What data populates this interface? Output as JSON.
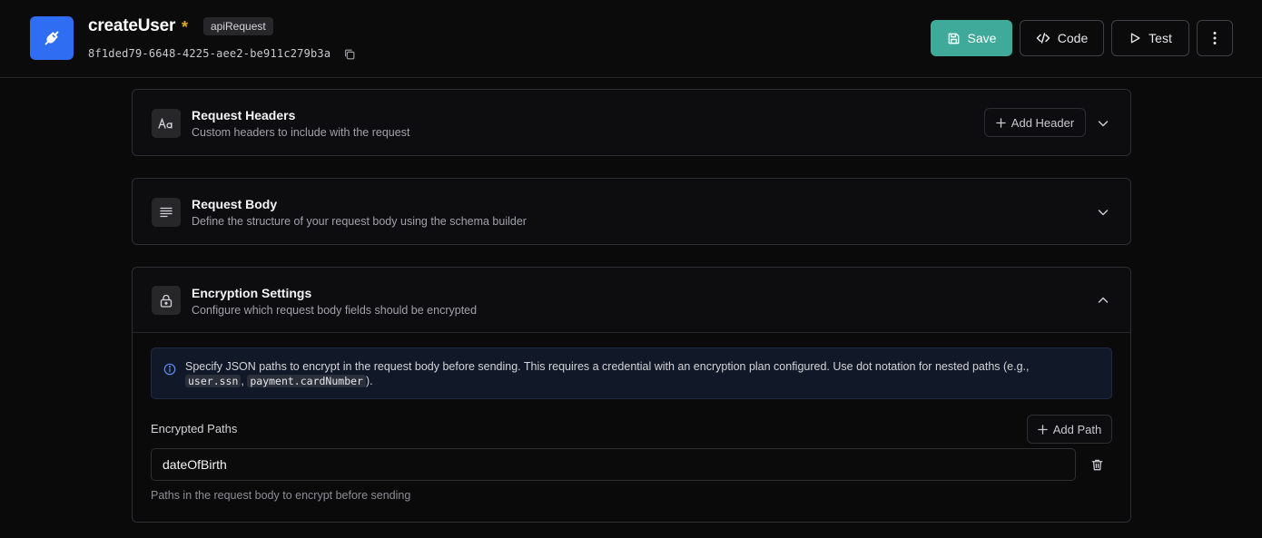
{
  "header": {
    "title": "createUser",
    "unsaved_marker": "*",
    "type_badge": "apiRequest",
    "uuid": "8f1ded79-6648-4225-aee2-be911c279b3a",
    "app_icon": "plug-icon",
    "buttons": {
      "save": "Save",
      "code": "Code",
      "test": "Test"
    }
  },
  "sections": {
    "headers": {
      "title": "Request Headers",
      "subtitle": "Custom headers to include with the request",
      "action": "Add Header",
      "icon": "text-aa-icon"
    },
    "body": {
      "title": "Request Body",
      "subtitle": "Define the structure of your request body using the schema builder",
      "icon": "align-left-icon"
    },
    "encryption": {
      "title": "Encryption Settings",
      "subtitle": "Configure which request body fields should be encrypted",
      "icon": "lock-icon",
      "info": {
        "text_before": "Specify JSON paths to encrypt in the request body before sending. This requires a credential with an encryption plan configured. Use dot notation for nested paths (e.g., ",
        "example1": "user.ssn",
        "sep": ", ",
        "example2": "payment.cardNumber",
        "text_after": ")."
      },
      "paths_label": "Encrypted Paths",
      "add_path": "Add Path",
      "path_value": "dateOfBirth",
      "hint": "Paths in the request body to encrypt before sending"
    }
  },
  "colors": {
    "accent": "#3fa99a",
    "app_icon_bg": "#2f6df2",
    "asterisk": "#e0a92b"
  }
}
